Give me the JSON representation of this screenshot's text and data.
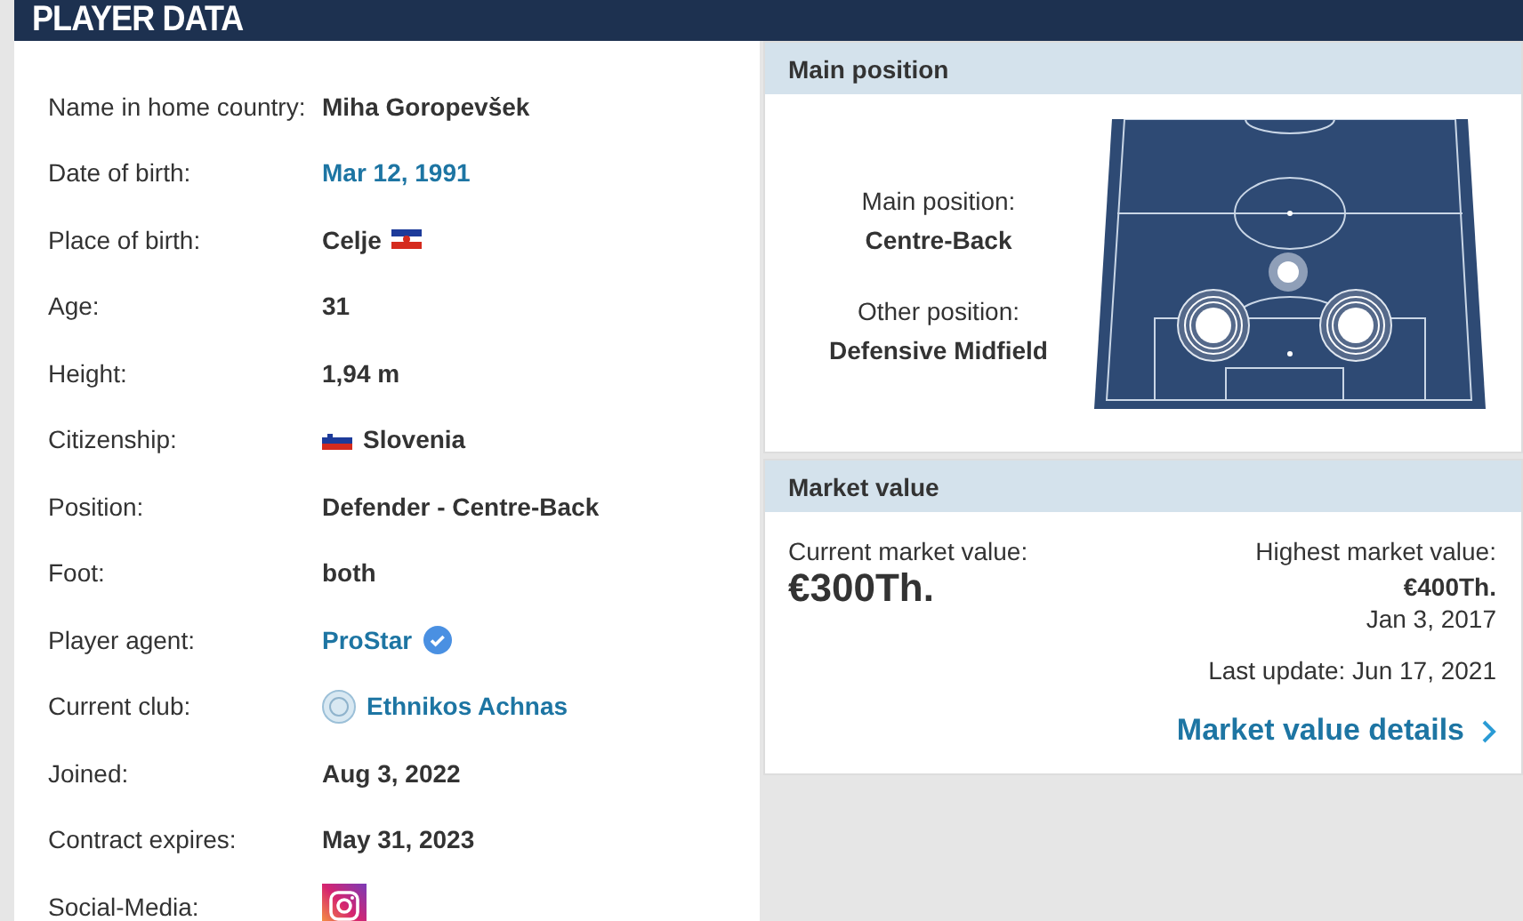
{
  "header": {
    "title": "PLAYER DATA"
  },
  "rows": [
    {
      "label": "Name in home country:",
      "value": "Miha Goropevšek",
      "kind": "text"
    },
    {
      "label": "Date of birth:",
      "value": "Mar 12, 1991",
      "kind": "link"
    },
    {
      "label": "Place of birth:",
      "value": "Celje",
      "kind": "birthplace"
    },
    {
      "label": "Age:",
      "value": "31",
      "kind": "text"
    },
    {
      "label": "Height:",
      "value": "1,94 m",
      "kind": "text"
    },
    {
      "label": "Citizenship:",
      "value": "Slovenia",
      "kind": "citizenship"
    },
    {
      "label": "Position:",
      "value": "Defender - Centre-Back",
      "kind": "text"
    },
    {
      "label": "Foot:",
      "value": "both",
      "kind": "text"
    },
    {
      "label": "Player agent:",
      "value": "ProStar",
      "kind": "agent"
    },
    {
      "label": "Current club:",
      "value": "Ethnikos Achnas",
      "kind": "club"
    },
    {
      "label": "Joined:",
      "value": "Aug 3, 2022",
      "kind": "text"
    },
    {
      "label": "Contract expires:",
      "value": "May 31, 2023",
      "kind": "text"
    },
    {
      "label": "Social-Media:",
      "kind": "social"
    }
  ],
  "main_position": {
    "title": "Main position",
    "main_label": "Main position:",
    "main_value": "Centre-Back",
    "other_label": "Other position:",
    "other_value": "Defensive Midfield"
  },
  "market_value": {
    "title": "Market value",
    "current_label": "Current market value:",
    "current_value": "€300Th.",
    "highest_label": "Highest market value:",
    "highest_value": "€400Th.",
    "highest_date": "Jan 3, 2017",
    "last_update": "Last update: Jun 17, 2021",
    "details_link": "Market value details"
  }
}
